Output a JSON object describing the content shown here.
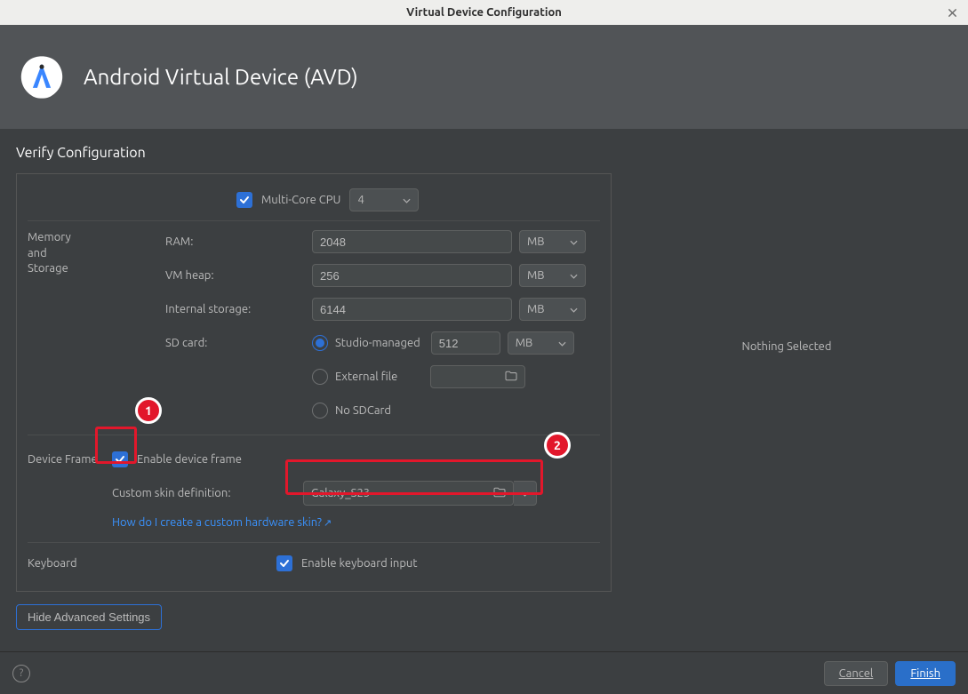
{
  "window": {
    "title": "Virtual Device Configuration"
  },
  "banner": {
    "title": "Android Virtual Device (AVD)"
  },
  "section": {
    "title": "Verify Configuration"
  },
  "cpu": {
    "label": "Multi-Core CPU",
    "value": "4"
  },
  "memory": {
    "section_label": "Memory\nand\nStorage",
    "ram_label": "RAM:",
    "ram_value": "2048",
    "ram_unit": "MB",
    "vm_label": "VM heap:",
    "vm_value": "256",
    "vm_unit": "MB",
    "is_label": "Internal storage:",
    "is_value": "6144",
    "is_unit": "MB",
    "sd_label": "SD card:",
    "sd_managed_label": "Studio-managed",
    "sd_value": "512",
    "sd_unit": "MB",
    "sd_external_label": "External file",
    "sd_none_label": "No SDCard"
  },
  "frame": {
    "section_label": "Device Frame",
    "enable_label": "Enable device frame",
    "skin_label": "Custom skin definition:",
    "skin_value": "Galaxy_S23",
    "help_link": "How do I create a custom hardware skin?"
  },
  "keyboard": {
    "section_label": "Keyboard",
    "enable_label": "Enable keyboard input"
  },
  "advanced_button": "Hide Advanced Settings",
  "side_info": "Nothing Selected",
  "footer": {
    "cancel": "Cancel",
    "finish": "Finish"
  },
  "annotations": {
    "one": "1",
    "two": "2"
  }
}
